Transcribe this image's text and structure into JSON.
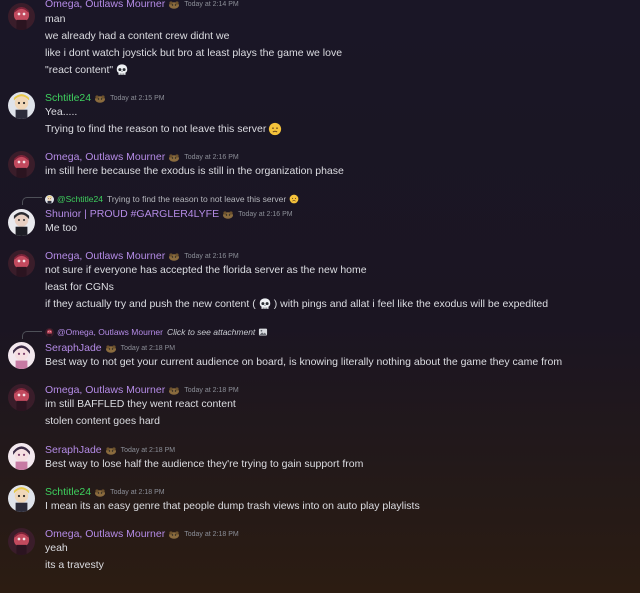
{
  "colors": {
    "purple_name": "#b48be6",
    "green_name": "#3ed15e",
    "timestamp": "#8b8e97",
    "text": "#dcdde2"
  },
  "messages": [
    {
      "author": "Omega, Outlaws Mourner",
      "timestamp": "Today at 2:14 PM",
      "lines": [
        "man",
        "we already had a content crew didnt we",
        "like i dont watch joystick but bro at least plays the game we love",
        "\"react content\""
      ]
    },
    {
      "author": "Schtitle24",
      "timestamp": "Today at 2:15 PM",
      "lines": [
        "Yea.....",
        "Trying to find the reason to not leave this server"
      ]
    },
    {
      "author": "Omega, Outlaws Mourner",
      "timestamp": "Today at 2:16 PM",
      "lines": [
        "im still here because the exodus is still in the organization phase"
      ]
    },
    {
      "reply_mention": "@Schtitle24",
      "reply_text": "Trying to find the reason to not leave this server",
      "author": "Shunior | PROUD #GARGLER4LYFE",
      "timestamp": "Today at 2:16 PM",
      "lines": [
        "Me too"
      ]
    },
    {
      "author": "Omega, Outlaws Mourner",
      "timestamp": "Today at 2:16 PM",
      "lines": [
        "not sure if everyone has accepted the florida server as the new home",
        "least for CGNs",
        "if they actually try and push the new content (",
        ") with pings and allat i feel like the exodus will be expedited"
      ]
    },
    {
      "reply_mention": "@Omega, Outlaws Mourner",
      "reply_text": "Click to see attachment",
      "author": "SeraphJade",
      "timestamp": "Today at 2:18 PM",
      "lines": [
        "Best way to not get your current audience on board, is knowing literally nothing about the game they came from"
      ]
    },
    {
      "author": "Omega, Outlaws Mourner",
      "timestamp": "Today at 2:18 PM",
      "lines": [
        "im still BAFFLED they went react content",
        "stolen content goes hard"
      ]
    },
    {
      "author": "SeraphJade",
      "timestamp": "Today at 2:18 PM",
      "lines": [
        "Best way to lose half the audience they're trying to gain support from"
      ]
    },
    {
      "author": "Schtitle24",
      "timestamp": "Today at 2:18 PM",
      "lines": [
        "I mean its an easy genre that people dump trash views into on auto play playlists"
      ]
    },
    {
      "author": "Omega, Outlaws Mourner",
      "timestamp": "Today at 2:18 PM",
      "lines": [
        "yeah",
        "its a travesty"
      ]
    }
  ]
}
